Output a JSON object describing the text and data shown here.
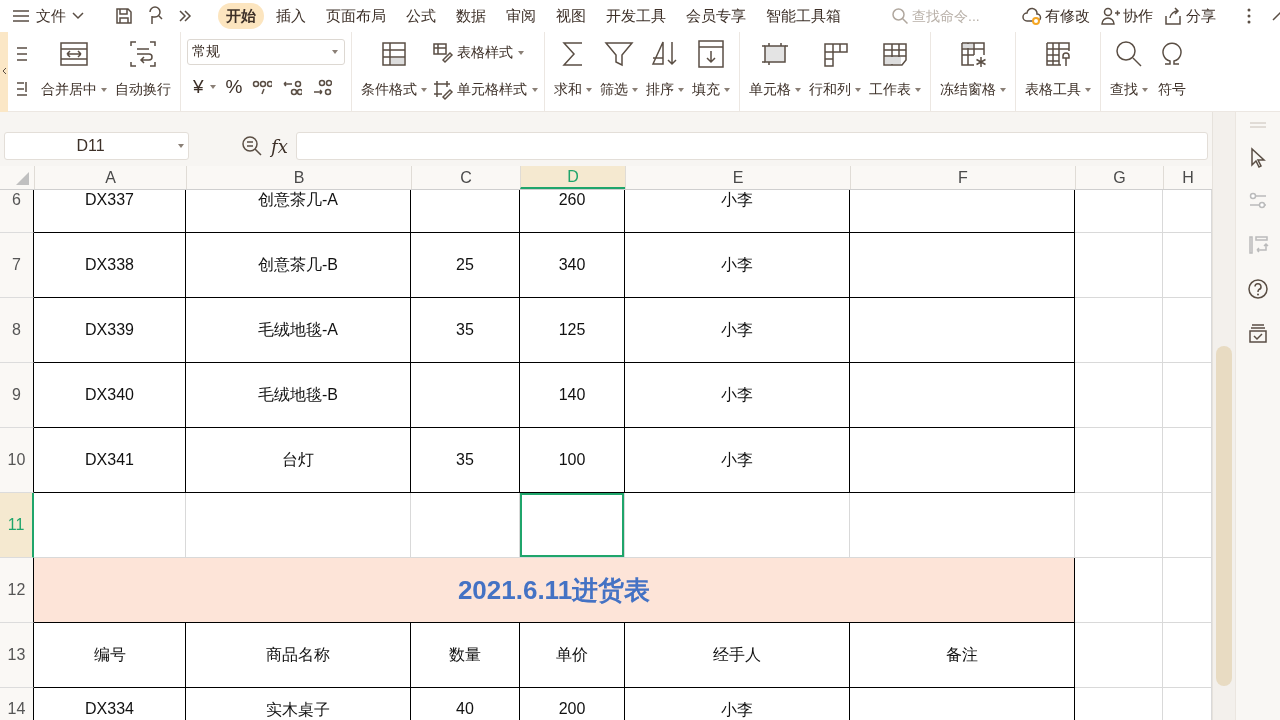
{
  "menu_bar": {
    "file_menu": "文件",
    "tabs": [
      {
        "label": "开始",
        "selected": true
      },
      {
        "label": "插入",
        "selected": false
      },
      {
        "label": "页面布局",
        "selected": false
      },
      {
        "label": "公式",
        "selected": false
      },
      {
        "label": "数据",
        "selected": false
      },
      {
        "label": "审阅",
        "selected": false
      },
      {
        "label": "视图",
        "selected": false
      },
      {
        "label": "开发工具",
        "selected": false
      },
      {
        "label": "会员专享",
        "selected": false
      },
      {
        "label": "智能工具箱",
        "selected": false
      }
    ],
    "search": {
      "placeholder": "查找命令..."
    },
    "actions": [
      "有修改",
      "协作",
      "分享"
    ]
  },
  "ribbon": {
    "groups": [
      [
        {
          "kind": "stack"
        },
        {
          "kind": "large",
          "label": "合并居中",
          "caret": true
        },
        {
          "kind": "large",
          "label": "自动换行",
          "caret": false
        }
      ],
      [
        {
          "kind": "select",
          "value": "常规"
        },
        {
          "kind": "glyph",
          "label": "¥",
          "caret": true
        },
        {
          "kind": "glyph",
          "label": "%",
          "caret": false
        },
        {
          "kind": "icon"
        },
        {
          "kind": "icon"
        },
        {
          "kind": "icon"
        }
      ],
      [
        {
          "kind": "large",
          "label": "条件格式",
          "caret": true
        },
        {
          "kind": "small",
          "label": "表格样式",
          "caret": true
        },
        {
          "kind": "small",
          "label": "单元格样式",
          "caret": true
        }
      ],
      [
        {
          "kind": "large",
          "label": "求和",
          "caret": true
        },
        {
          "kind": "large",
          "label": "筛选",
          "caret": true
        },
        {
          "kind": "large",
          "label": "排序",
          "caret": true
        },
        {
          "kind": "large",
          "label": "填充",
          "caret": true
        }
      ],
      [
        {
          "kind": "large",
          "label": "单元格",
          "caret": true
        },
        {
          "kind": "large",
          "label": "行和列",
          "caret": true
        },
        {
          "kind": "large",
          "label": "工作表",
          "caret": true
        }
      ],
      [
        {
          "kind": "large",
          "label": "冻结窗格",
          "caret": true
        }
      ],
      [
        {
          "kind": "large",
          "label": "表格工具",
          "caret": true
        }
      ],
      [
        {
          "kind": "large",
          "label": "查找",
          "caret": true
        },
        {
          "kind": "large",
          "label": "符号",
          "caret": false
        }
      ]
    ]
  },
  "sheet": {
    "name_box": "D11",
    "formula": {
      "label": "fx"
    },
    "columns": [
      {
        "label": "A",
        "selected": false
      },
      {
        "label": "B",
        "selected": false
      },
      {
        "label": "C",
        "selected": false
      },
      {
        "label": "D",
        "selected": true
      },
      {
        "label": "E",
        "selected": false
      },
      {
        "label": "F",
        "selected": false
      },
      {
        "label": "G",
        "selected": false
      },
      {
        "label": "H",
        "selected": false
      }
    ],
    "rows": [
      {
        "number": "6",
        "kind": "data",
        "selected": false,
        "cells": {
          "A": "DX337",
          "B": "创意茶几-A",
          "D": "260",
          "E": "小李"
        }
      },
      {
        "number": "7",
        "kind": "data",
        "selected": false,
        "cells": {
          "A": "DX338",
          "B": "创意茶几-B",
          "C": "25",
          "D": "340",
          "E": "小李"
        }
      },
      {
        "number": "8",
        "kind": "data",
        "selected": false,
        "cells": {
          "A": "DX339",
          "B": "毛绒地毯-A",
          "C": "35",
          "D": "125",
          "E": "小李"
        }
      },
      {
        "number": "9",
        "kind": "data",
        "selected": false,
        "cells": {
          "A": "DX340",
          "B": "毛绒地毯-B",
          "D": "140",
          "E": "小李"
        }
      },
      {
        "number": "10",
        "kind": "data",
        "selected": false,
        "cells": {
          "A": "DX341",
          "B": "台灯",
          "C": "35",
          "D": "100",
          "E": "小李"
        }
      },
      {
        "number": "11",
        "kind": "blank",
        "selected": true,
        "cells": {}
      },
      {
        "number": "12",
        "kind": "title",
        "selected": false,
        "title": "2021.6.11进货表"
      },
      {
        "number": "13",
        "kind": "data",
        "selected": false,
        "cells": {
          "A": "编号",
          "B": "商品名称",
          "C": "数量",
          "D": "单价",
          "E": "经手人",
          "F": "备注"
        }
      },
      {
        "number": "14",
        "kind": "data",
        "selected": false,
        "cells": {
          "A": "DX334",
          "B": "实木桌子",
          "C": "40",
          "D": "200",
          "E": "小李"
        }
      }
    ]
  }
}
